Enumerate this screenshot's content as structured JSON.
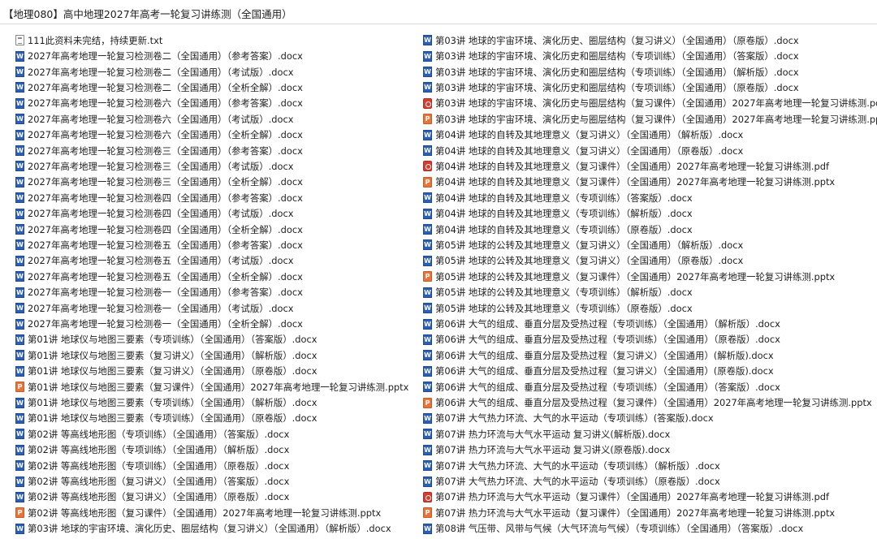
{
  "folder": {
    "title": "【地理080】高中地理2027年高考一轮复习讲练测（全国通用）"
  },
  "files_left": [
    {
      "type": "txt",
      "name": "111此资料未完结，持续更新.txt"
    },
    {
      "type": "docx",
      "name": "2027年高考地理一轮复习检测卷二（全国通用）（参考答案）.docx"
    },
    {
      "type": "docx",
      "name": "2027年高考地理一轮复习检测卷二（全国通用）（考试版）.docx"
    },
    {
      "type": "docx",
      "name": "2027年高考地理一轮复习检测卷二（全国通用）（全析全解）.docx"
    },
    {
      "type": "docx",
      "name": "2027年高考地理一轮复习检测卷六（全国通用）（参考答案）.docx"
    },
    {
      "type": "docx",
      "name": "2027年高考地理一轮复习检测卷六（全国通用）（考试版）.docx"
    },
    {
      "type": "docx",
      "name": "2027年高考地理一轮复习检测卷六（全国通用）（全析全解）.docx"
    },
    {
      "type": "docx",
      "name": "2027年高考地理一轮复习检测卷三（全国通用）（参考答案）.docx"
    },
    {
      "type": "docx",
      "name": "2027年高考地理一轮复习检测卷三（全国通用）（考试版）.docx"
    },
    {
      "type": "docx",
      "name": "2027年高考地理一轮复习检测卷三（全国通用）（全析全解）.docx"
    },
    {
      "type": "docx",
      "name": "2027年高考地理一轮复习检测卷四（全国通用）（参考答案）.docx"
    },
    {
      "type": "docx",
      "name": "2027年高考地理一轮复习检测卷四（全国通用）（考试版）.docx"
    },
    {
      "type": "docx",
      "name": "2027年高考地理一轮复习检测卷四（全国通用）（全析全解）.docx"
    },
    {
      "type": "docx",
      "name": "2027年高考地理一轮复习检测卷五（全国通用）（参考答案）.docx"
    },
    {
      "type": "docx",
      "name": "2027年高考地理一轮复习检测卷五（全国通用）（考试版）.docx"
    },
    {
      "type": "docx",
      "name": "2027年高考地理一轮复习检测卷五（全国通用）（全析全解）.docx"
    },
    {
      "type": "docx",
      "name": "2027年高考地理一轮复习检测卷一（全国通用）（参考答案）.docx"
    },
    {
      "type": "docx",
      "name": "2027年高考地理一轮复习检测卷一（全国通用）（考试版）.docx"
    },
    {
      "type": "docx",
      "name": "2027年高考地理一轮复习检测卷一（全国通用）（全析全解）.docx"
    },
    {
      "type": "docx",
      "name": "第01讲 地球仪与地图三要素（专项训练）（全国通用）（答案版）.docx"
    },
    {
      "type": "docx",
      "name": "第01讲 地球仪与地图三要素（复习讲义）（全国通用）（解析版）.docx"
    },
    {
      "type": "docx",
      "name": "第01讲 地球仪与地图三要素（复习讲义）（全国通用）（原卷版）.docx"
    },
    {
      "type": "pptx",
      "name": "第01讲 地球仪与地图三要素（复习课件）（全国通用）2027年高考地理一轮复习讲练测.pptx"
    },
    {
      "type": "docx",
      "name": "第01讲 地球仪与地图三要素（专项训练）（全国通用）（解析版）.docx"
    },
    {
      "type": "docx",
      "name": "第01讲 地球仪与地图三要素（专项训练）（全国通用）（原卷版）.docx"
    },
    {
      "type": "docx",
      "name": "第02讲 等高线地形图（专项训练）（全国通用）（答案版）.docx"
    },
    {
      "type": "docx",
      "name": "第02讲 等高线地形图（专项训练）（全国通用）（解析版）.docx"
    },
    {
      "type": "docx",
      "name": "第02讲 等高线地形图（专项训练）（全国通用）（原卷版）.docx"
    },
    {
      "type": "docx",
      "name": "第02讲 等高线地形图（复习讲义）（全国通用）（答案版）.docx"
    },
    {
      "type": "docx",
      "name": "第02讲 等高线地形图（复习讲义）（全国通用）（原卷版）.docx"
    },
    {
      "type": "pptx",
      "name": "第02讲 等高线地形图（复习课件）（全国通用）2027年高考地理一轮复习讲练测.pptx"
    },
    {
      "type": "docx",
      "name": "第03讲 地球的宇宙环境、演化历史、圈层结构（复习讲义）（全国通用）（解析版）.docx"
    }
  ],
  "files_right": [
    {
      "type": "docx",
      "name": "第03讲 地球的宇宙环境、演化历史、圈层结构（复习讲义）（全国通用）（原卷版）.docx"
    },
    {
      "type": "docx",
      "name": "第03讲 地球的宇宙环境、演化历史和圈层结构（专项训练）（全国通用）（答案版）.docx"
    },
    {
      "type": "docx",
      "name": "第03讲 地球的宇宙环境、演化历史和圈层结构（专项训练）（全国通用）（解析版）.docx"
    },
    {
      "type": "docx",
      "name": "第03讲 地球的宇宙环境、演化历史和圈层结构（专项训练）（全国通用）（原卷版）.docx"
    },
    {
      "type": "pdf",
      "name": "第03讲 地球的宇宙环境、演化历史与圈层结构（复习课件）（全国通用）2027年高考地理一轮复习讲练测.pdf"
    },
    {
      "type": "pptx",
      "name": "第03讲 地球的宇宙环境、演化历史与圈层结构（复习课件）（全国通用）2027年高考地理一轮复习讲练测.pptx"
    },
    {
      "type": "docx",
      "name": "第04讲 地球的自转及其地理意义（复习讲义）（全国通用）（解析版）.docx"
    },
    {
      "type": "docx",
      "name": "第04讲 地球的自转及其地理意义（复习讲义）（全国通用）（原卷版）.docx"
    },
    {
      "type": "pdf",
      "name": "第04讲 地球的自转及其地理意义（复习课件）（全国通用）2027年高考地理一轮复习讲练测.pdf"
    },
    {
      "type": "pptx",
      "name": "第04讲 地球的自转及其地理意义（复习课件）（全国通用）2027年高考地理一轮复习讲练测.pptx"
    },
    {
      "type": "docx",
      "name": "第04讲 地球的自转及其地理意义（专项训练）（答案版）.docx"
    },
    {
      "type": "docx",
      "name": "第04讲 地球的自转及其地理意义（专项训练）（解析版）.docx"
    },
    {
      "type": "docx",
      "name": "第04讲 地球的自转及其地理意义（专项训练）（原卷版）.docx"
    },
    {
      "type": "docx",
      "name": "第05讲 地球的公转及其地理意义（复习讲义）（全国通用）（解析版）.docx"
    },
    {
      "type": "docx",
      "name": "第05讲 地球的公转及其地理意义（复习讲义）（全国通用）（原卷版）.docx"
    },
    {
      "type": "pptx",
      "name": "第05讲 地球的公转及其地理意义（复习课件）（全国通用）2027年高考地理一轮复习讲练测.pptx"
    },
    {
      "type": "docx",
      "name": "第05讲 地球的公转及其地理意义（专项训练）（解析版）.docx"
    },
    {
      "type": "docx",
      "name": "第05讲 地球的公转及其地理意义（专项训练）（原卷版）.docx"
    },
    {
      "type": "docx",
      "name": "第06讲 大气的组成、垂直分层及受热过程（专项训练）（全国通用）（解析版）.docx"
    },
    {
      "type": "docx",
      "name": "第06讲 大气的组成、垂直分层及受热过程（专项训练）（全国通用）（原卷版）.docx"
    },
    {
      "type": "docx",
      "name": "第06讲 大气的组成、垂直分层及受热过程（复习讲义）（全国通用）(解析版).docx"
    },
    {
      "type": "docx",
      "name": "第06讲 大气的组成、垂直分层及受热过程（复习讲义）（全国通用）(原卷版).docx"
    },
    {
      "type": "docx",
      "name": "第06讲 大气的组成、垂直分层及受热过程（专项训练）（全国通用）（答案版）.docx"
    },
    {
      "type": "pptx",
      "name": "第06讲 大气的组成、垂直分层及受热过程（复习课件）（全国通用）2027年高考地理一轮复习讲练测.pptx"
    },
    {
      "type": "docx",
      "name": "第07讲 大气热力环流、大气的水平运动（专项训练）(答案版).docx"
    },
    {
      "type": "docx",
      "name": "第07讲 热力环流与大气水平运动 复习讲义(解析版).docx"
    },
    {
      "type": "docx",
      "name": "第07讲 热力环流与大气水平运动 复习讲义(原卷版).docx"
    },
    {
      "type": "docx",
      "name": "第07讲 大气热力环流、大气的水平运动（专项训练）（解析版）.docx"
    },
    {
      "type": "docx",
      "name": "第07讲 大气热力环流、大气的水平运动（专项训练）（原卷版）.docx"
    },
    {
      "type": "pdf",
      "name": "第07讲 热力环流与大气水平运动（复习课件）（全国通用）2027年高考地理一轮复习讲练测.pdf"
    },
    {
      "type": "pptx",
      "name": "第07讲 热力环流与大气水平运动（复习课件）（全国通用）2027年高考地理一轮复习讲练测.pptx"
    },
    {
      "type": "docx",
      "name": "第08讲 气压带、风带与气候（大气环流与气候）（专项训练）（全国通用）（答案版）.docx"
    }
  ]
}
